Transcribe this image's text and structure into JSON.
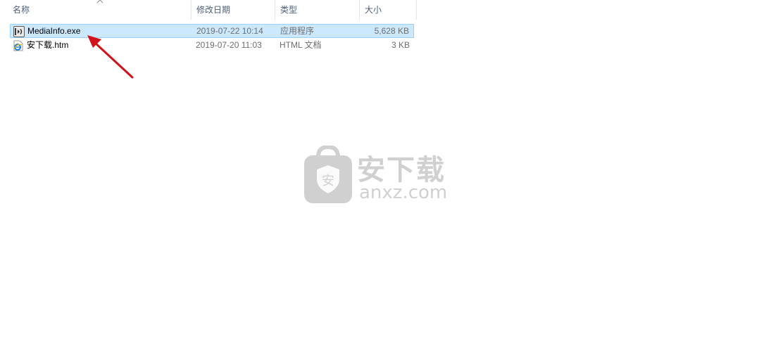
{
  "columns": {
    "name": "名称",
    "modified": "修改日期",
    "type": "类型",
    "size": "大小"
  },
  "files": [
    {
      "name": "MediaInfo.exe",
      "modified": "2019-07-22 10:14",
      "type": "应用程序",
      "size": "5,628 KB",
      "icon": "exe-app-icon",
      "selected": true
    },
    {
      "name": "安下载.htm",
      "modified": "2019-07-20 11:03",
      "type": "HTML 文档",
      "size": "3 KB",
      "icon": "ie-html-icon",
      "selected": false
    }
  ],
  "watermark": {
    "brand_cn": "安下载",
    "brand_en": "anxz.com",
    "badge_char": "安"
  },
  "colors": {
    "selection_bg": "#cce8ff",
    "selection_border": "#99d1ff",
    "header_text": "#4c607a",
    "annotation_arrow": "#d0121b"
  }
}
